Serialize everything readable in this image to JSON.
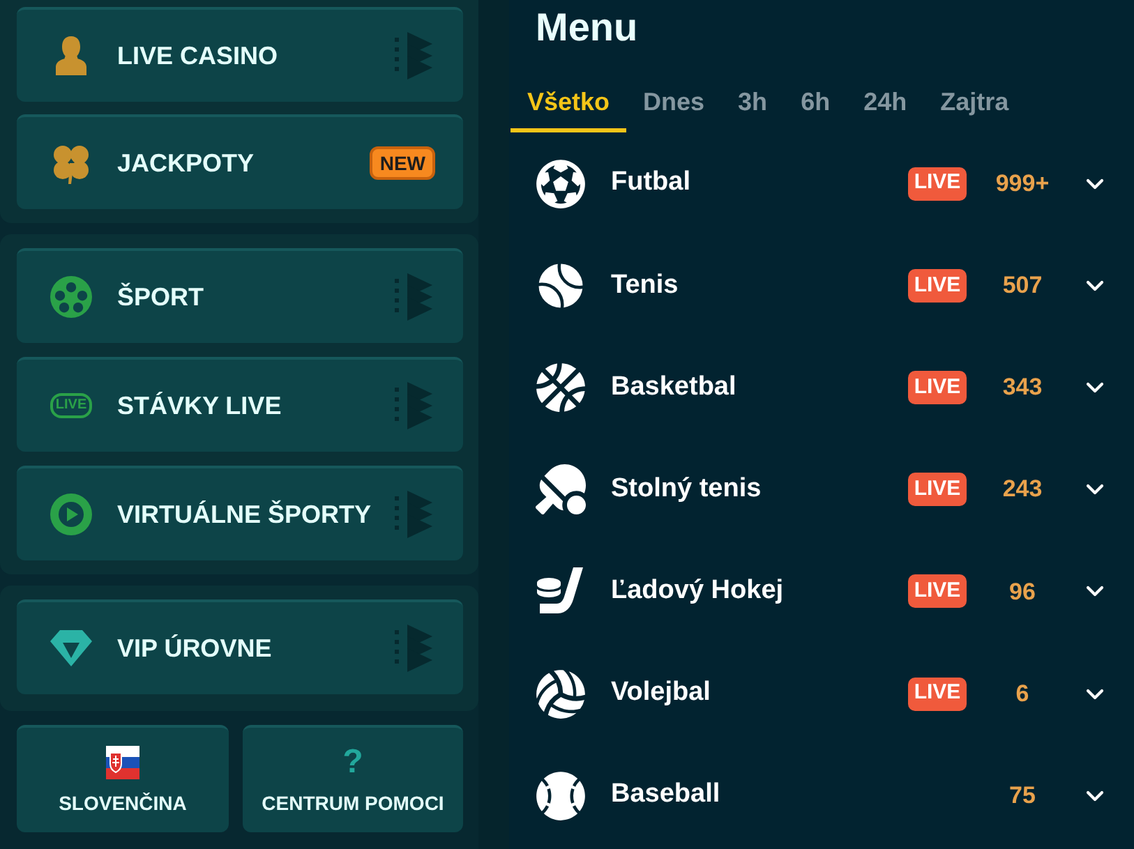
{
  "sidebar": {
    "groups": [
      {
        "items": [
          {
            "label": "LIVE CASINO"
          },
          {
            "label": "JACKPOTY",
            "badge": "NEW"
          }
        ]
      },
      {
        "items": [
          {
            "label": "ŠPORT"
          },
          {
            "label": "STÁVKY LIVE",
            "icon_text": "LIVE"
          },
          {
            "label": "VIRTUÁLNE ŠPORTY"
          }
        ]
      },
      {
        "items": [
          {
            "label": "VIP ÚROVNE"
          }
        ]
      }
    ],
    "footer": [
      {
        "label": "SLOVENČINA"
      },
      {
        "label": "CENTRUM POMOCI",
        "icon_text": "?"
      }
    ]
  },
  "menu": {
    "title": "Menu",
    "tabs": [
      {
        "label": "Všetko",
        "selected": true
      },
      {
        "label": "Dnes",
        "selected": false
      },
      {
        "label": "3h",
        "selected": false
      },
      {
        "label": "6h",
        "selected": false
      },
      {
        "label": "24h",
        "selected": false
      },
      {
        "label": "Zajtra",
        "selected": false
      }
    ],
    "sports": [
      {
        "name": "Futbal",
        "badge": "LIVE",
        "count": "999+"
      },
      {
        "name": "Tenis",
        "badge": "LIVE",
        "count": "507"
      },
      {
        "name": "Basketbal",
        "badge": "LIVE",
        "count": "343"
      },
      {
        "name": "Stolný tenis",
        "badge": "LIVE",
        "count": "243"
      },
      {
        "name": "Ľadový Hokej",
        "badge": "LIVE",
        "count": "96"
      },
      {
        "name": "Volejbal",
        "badge": "LIVE",
        "count": "6"
      },
      {
        "name": "Baseball",
        "count": "75"
      }
    ]
  }
}
